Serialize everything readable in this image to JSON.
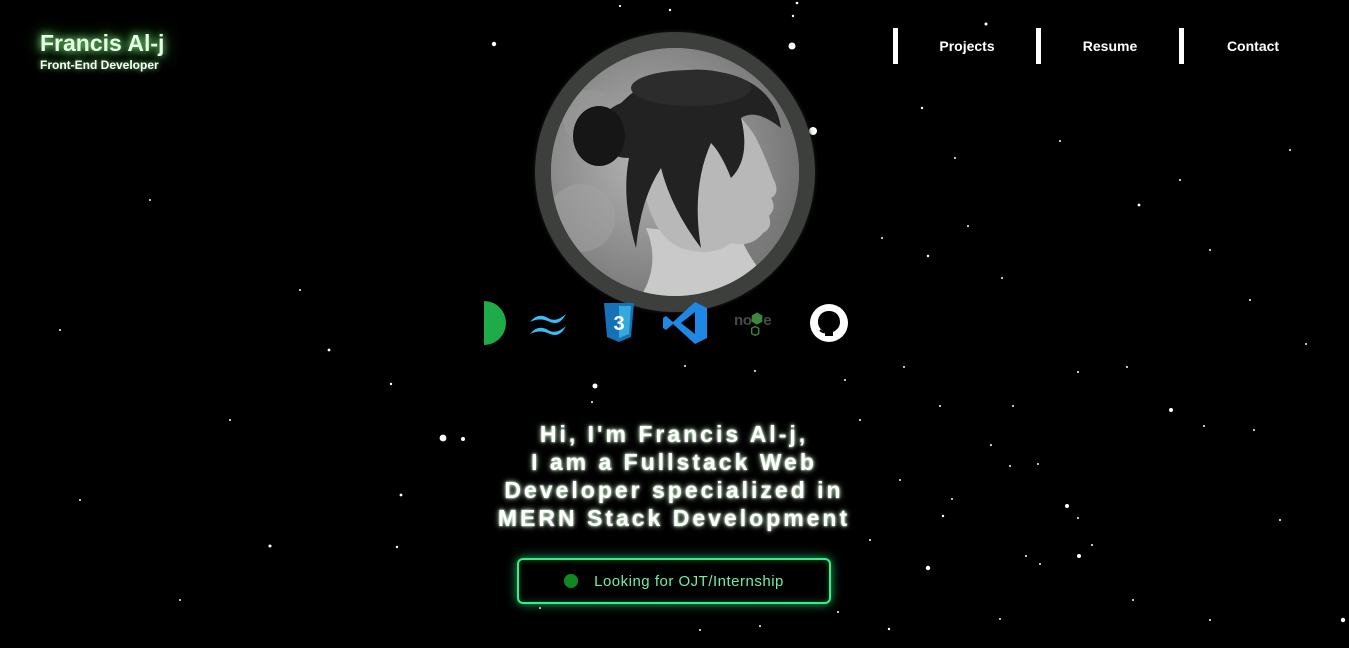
{
  "brand": {
    "name": "Francis Al-j",
    "role": "Front-End Developer"
  },
  "nav": {
    "items": [
      "Projects",
      "Resume",
      "Contact"
    ]
  },
  "profile": {
    "photo_alt": "profile-photo"
  },
  "tech_stack": [
    "mongodb-icon",
    "tailwind-icon",
    "css3-icon",
    "vscode-icon",
    "nodejs-icon",
    "github-icon"
  ],
  "hero": {
    "line1": "Hi, I'm Francis Al-j,",
    "line2": "I am a Fullstack Web",
    "line3": "Developer specialized in",
    "line4": "MERN Stack Development"
  },
  "cta": {
    "label": "Looking for OJT/Internship"
  },
  "colors": {
    "accent": "#35f08a",
    "background": "#000000",
    "glow": "#8cff8c"
  }
}
